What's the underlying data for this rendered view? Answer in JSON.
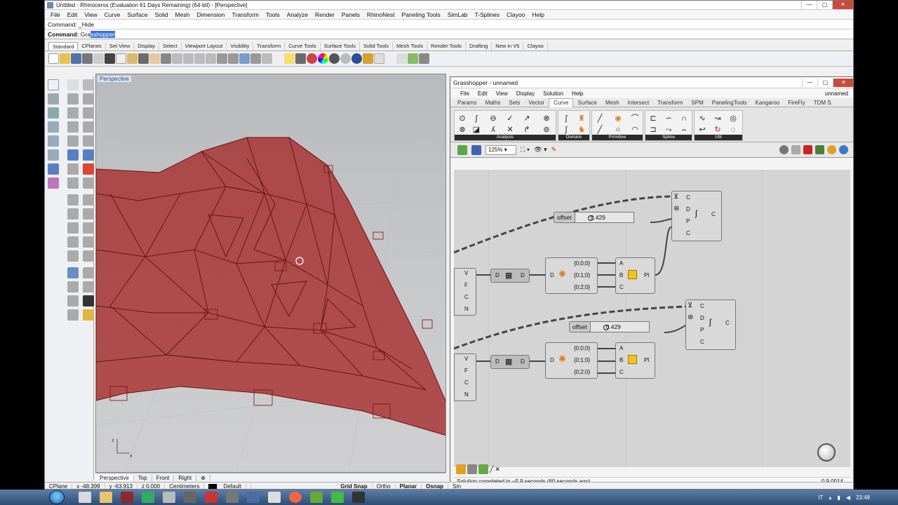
{
  "rhino": {
    "title": "Untitled - Rhinoceros (Evaluation 61 Days Remaining) (64-bit) - [Perspective]",
    "menu": [
      "File",
      "Edit",
      "View",
      "Curve",
      "Surface",
      "Solid",
      "Mesh",
      "Dimension",
      "Transform",
      "Tools",
      "Analyze",
      "Render",
      "Panels",
      "RhinoNest",
      "Paneling Tools",
      "SimLab",
      "T-Splines",
      "Clayoo",
      "Help"
    ],
    "command_history": "Command: _Hide",
    "command_prompt": "Command:",
    "command_typed": "Gra",
    "command_selected": "sshopper",
    "toolbar_tabs": [
      "Standard",
      "CPlanes",
      "Set View",
      "Display",
      "Select",
      "Viewport Layout",
      "Visibility",
      "Transform",
      "Curve Tools",
      "Surface Tools",
      "Solid Tools",
      "Mesh Tools",
      "Render Tools",
      "Drafting",
      "New in V5",
      "Clayoo"
    ],
    "viewport_label": "Perspective",
    "viewport_tabs": [
      "Perspective",
      "Top",
      "Front",
      "Right"
    ],
    "status": {
      "cplane": "CPlane",
      "x": "x -48.399",
      "y": "y -63.913",
      "z": "z 0.000",
      "units": "Centimeters",
      "layer": "Default",
      "modes": [
        "Grid Snap",
        "Ortho",
        "Planar",
        "Osnap",
        "Sm"
      ]
    }
  },
  "gh": {
    "title": "Grasshopper - unnamed",
    "doc_name": "unnamed",
    "menu": [
      "File",
      "Edit",
      "View",
      "Display",
      "Solution",
      "Help"
    ],
    "tabs": [
      "Params",
      "Maths",
      "Sets",
      "Vector",
      "Curve",
      "Surface",
      "Mesh",
      "Intersect",
      "Transform",
      "SPM",
      "PanelingTools",
      "Kangaroo",
      "FireFly",
      "TDM S."
    ],
    "active_tab": "Curve",
    "groups": [
      "Analysis",
      "Division",
      "Primitive",
      "Spline",
      "Util"
    ],
    "zoom": "125%",
    "status": "Solution completed in ~5.9 seconds (60 seconds ago)",
    "version": "0.9.0014"
  },
  "nodes": {
    "offset1": {
      "name": "offset",
      "value": "0.429"
    },
    "offset2": {
      "name": "offset",
      "value": "0.429"
    },
    "offset_inputs": [
      "C",
      "D",
      "P",
      "C"
    ],
    "offset_output": "C",
    "mesh_inputs": [
      "V",
      "F",
      "C",
      "N"
    ],
    "dec_in": "D",
    "dec_out": "D",
    "tree_in": "D",
    "tree_out": [
      "{0;0;0}",
      "{0;1;0}",
      "{0;2;0}"
    ],
    "plane_in": [
      "A",
      "B",
      "C"
    ],
    "plane_out": "Pl"
  },
  "taskbar": {
    "lang": "IT",
    "time": "23:48"
  },
  "colors": {
    "mesh_red": "#a31c1c",
    "accent_blue": "#3875d7"
  }
}
